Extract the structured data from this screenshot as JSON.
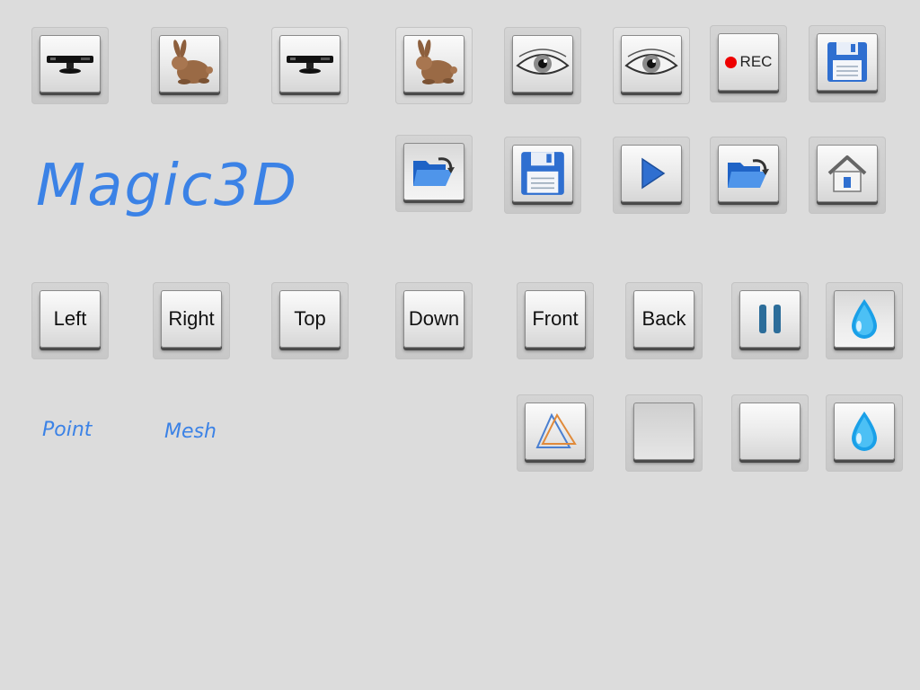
{
  "app": {
    "title": "Magic3D"
  },
  "toolbar_row1": [
    {
      "name": "kinect-button",
      "icon": "kinect-sensor-icon"
    },
    {
      "name": "bunny-model-button",
      "icon": "bunny-icon"
    },
    {
      "name": "kinect-button-2",
      "icon": "kinect-sensor-icon"
    },
    {
      "name": "bunny-model-button-2",
      "icon": "bunny-icon"
    },
    {
      "name": "eye-view-button",
      "icon": "eye-icon"
    },
    {
      "name": "eye-view-button-2",
      "icon": "eye-icon"
    },
    {
      "name": "record-button",
      "icon": "record-icon",
      "label": "REC"
    },
    {
      "name": "save-button",
      "icon": "floppy-disk-icon"
    }
  ],
  "toolbar_row2": [
    {
      "name": "open-folder-button",
      "icon": "open-folder-icon"
    },
    {
      "name": "save-button-2",
      "icon": "floppy-disk-icon"
    },
    {
      "name": "play-button",
      "icon": "play-icon"
    },
    {
      "name": "open-folder-button-2",
      "icon": "open-folder-icon"
    },
    {
      "name": "home-button",
      "icon": "home-icon"
    }
  ],
  "views": {
    "left": "Left",
    "right": "Right",
    "top": "Top",
    "down": "Down",
    "front": "Front",
    "back": "Back"
  },
  "mode": {
    "point": "Point",
    "mesh": "Mesh"
  },
  "colors": {
    "accent": "#3b82e6",
    "rec": "#ee0000",
    "icon_blue": "#2f6fd0"
  }
}
